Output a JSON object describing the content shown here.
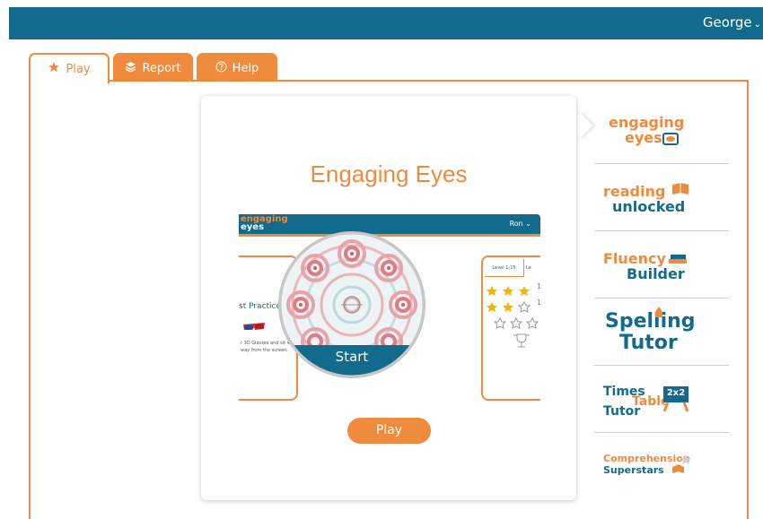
{
  "header": {
    "user_name": "George"
  },
  "tabs": [
    {
      "label": "Play",
      "icon": "star-icon",
      "active": true
    },
    {
      "label": "Report",
      "icon": "layers-icon",
      "active": false
    },
    {
      "label": "Help",
      "icon": "question-circle-icon",
      "active": false
    }
  ],
  "main": {
    "title": "Engaging Eyes",
    "preview": {
      "logo_line1": "engaging",
      "logo_line2": "eyes",
      "user_name": "Ron",
      "practice_label": "st  Practice A",
      "description": "r 3D Glasses and sit 40 way from the screen.",
      "level_tab1": "Level 1-15",
      "level_tab2": "Le",
      "start_label": "Start",
      "star_counts": [
        "1",
        "1"
      ]
    },
    "play_label": "Play"
  },
  "sidebar": {
    "products": [
      {
        "line1": "engaging",
        "line2": "eyes"
      },
      {
        "line1": "reading",
        "line2": "unlocked"
      },
      {
        "line1": "Fluency",
        "line2": "Builder"
      },
      {
        "line1": "Spelling",
        "line2": "Tutor"
      },
      {
        "line1": "Times",
        "line2": "Table",
        "line3": "Tutor",
        "badge": "2x2"
      },
      {
        "line1": "Comprehension",
        "line2": "Superstars"
      }
    ]
  },
  "colors": {
    "brand_blue": "#126b8c",
    "accent_orange": "#f08a3c"
  }
}
